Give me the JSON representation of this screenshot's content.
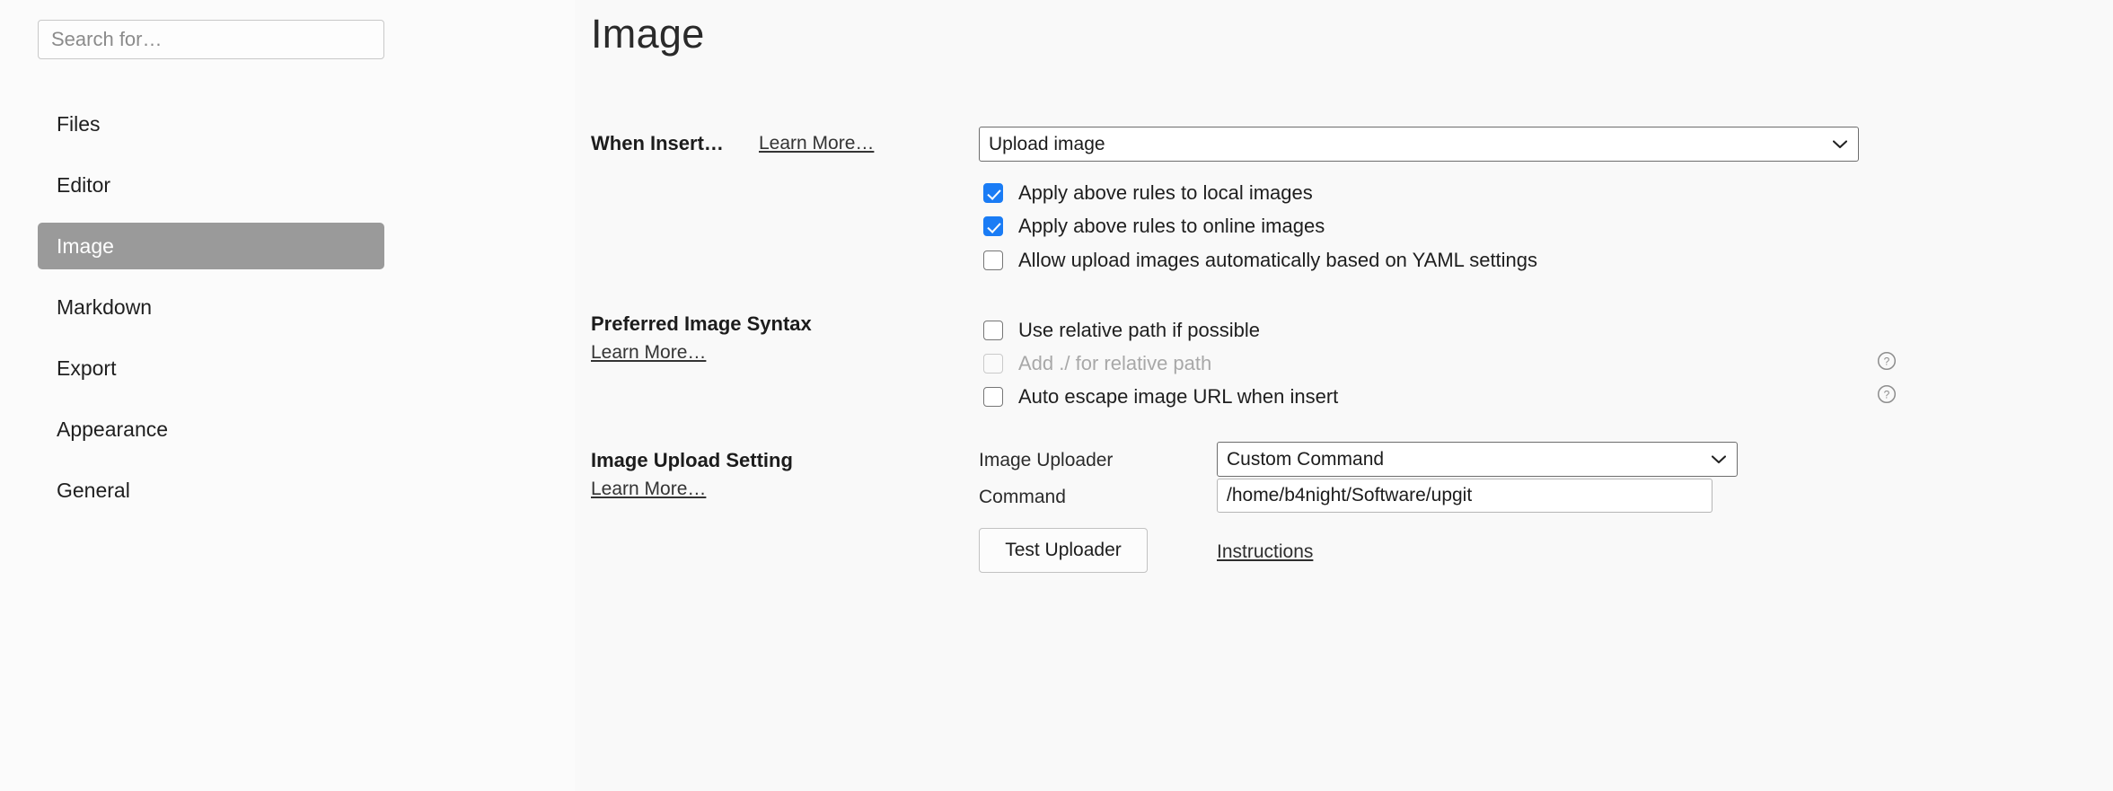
{
  "sidebar": {
    "search": {
      "placeholder": "Search for…",
      "value": ""
    },
    "items": [
      {
        "label": "Files",
        "selected": false
      },
      {
        "label": "Editor",
        "selected": false
      },
      {
        "label": "Image",
        "selected": true
      },
      {
        "label": "Markdown",
        "selected": false
      },
      {
        "label": "Export",
        "selected": false
      },
      {
        "label": "Appearance",
        "selected": false
      },
      {
        "label": "General",
        "selected": false
      }
    ]
  },
  "main": {
    "title": "Image",
    "sections": {
      "when_insert": {
        "label": "When Insert…",
        "learn_more": "Learn More…",
        "select": {
          "value": "Upload image",
          "icon": "chevron-down-icon"
        },
        "checkboxes": [
          {
            "label": "Apply above rules to local images",
            "checked": true,
            "disabled": false,
            "help": false
          },
          {
            "label": "Apply above rules to online images",
            "checked": true,
            "disabled": false,
            "help": false
          },
          {
            "label": "Allow upload images automatically based on YAML settings",
            "checked": false,
            "disabled": false,
            "help": false
          }
        ]
      },
      "preferred_syntax": {
        "label": "Preferred Image Syntax",
        "learn_more": "Learn More…",
        "checkboxes": [
          {
            "label": "Use relative path if possible",
            "checked": false,
            "disabled": false,
            "help": false
          },
          {
            "label": "Add ./ for relative path",
            "checked": false,
            "disabled": true,
            "help": true
          },
          {
            "label": "Auto escape image URL when insert",
            "checked": false,
            "disabled": false,
            "help": true
          }
        ]
      },
      "image_upload": {
        "label": "Image Upload Setting",
        "learn_more": "Learn More…",
        "uploader_label": "Image Uploader",
        "uploader_select": {
          "value": "Custom Command",
          "icon": "chevron-down-icon"
        },
        "command_label": "Command",
        "command_input": {
          "value": "/home/b4night/Software/upgit",
          "placeholder": ""
        },
        "test_button": "Test Uploader",
        "instructions_link": "Instructions"
      }
    },
    "help_icon_name": "question-mark-circle-icon"
  },
  "colors": {
    "accent_checkbox": "#1a7cf5",
    "selected_nav_bg": "#9a9a9a",
    "page_bg": "#f9f9f9",
    "sidebar_bg": "#fbfbfb"
  }
}
